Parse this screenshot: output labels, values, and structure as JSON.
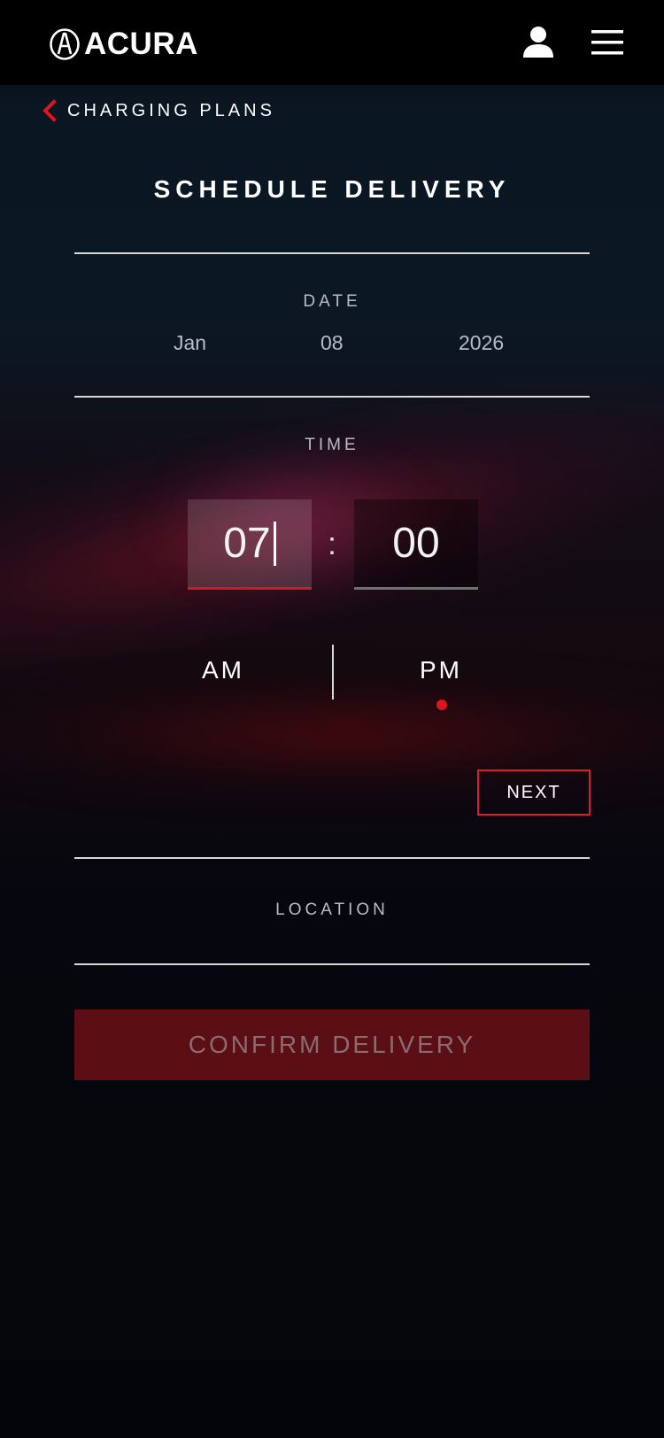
{
  "header": {
    "brand": "ACURA"
  },
  "nav": {
    "back_label": "CHARGING PLANS"
  },
  "page": {
    "title": "SCHEDULE DELIVERY"
  },
  "date": {
    "label": "DATE",
    "month": "Jan",
    "day": "08",
    "year": "2026"
  },
  "time": {
    "label": "TIME",
    "hour": "07",
    "separator": ":",
    "minute": "00",
    "am_label": "AM",
    "pm_label": "PM",
    "selected_period": "PM"
  },
  "actions": {
    "next_label": "NEXT",
    "confirm_label": "CONFIRM DELIVERY"
  },
  "location": {
    "label": "LOCATION"
  },
  "colors": {
    "accent": "#d91e24",
    "confirm_bg": "#5b0e14",
    "label": "#b9bcc4"
  },
  "icons": {
    "brand": "acura-logo-icon",
    "user": "user-icon",
    "menu": "hamburger-menu-icon",
    "back": "chevron-left-icon"
  }
}
